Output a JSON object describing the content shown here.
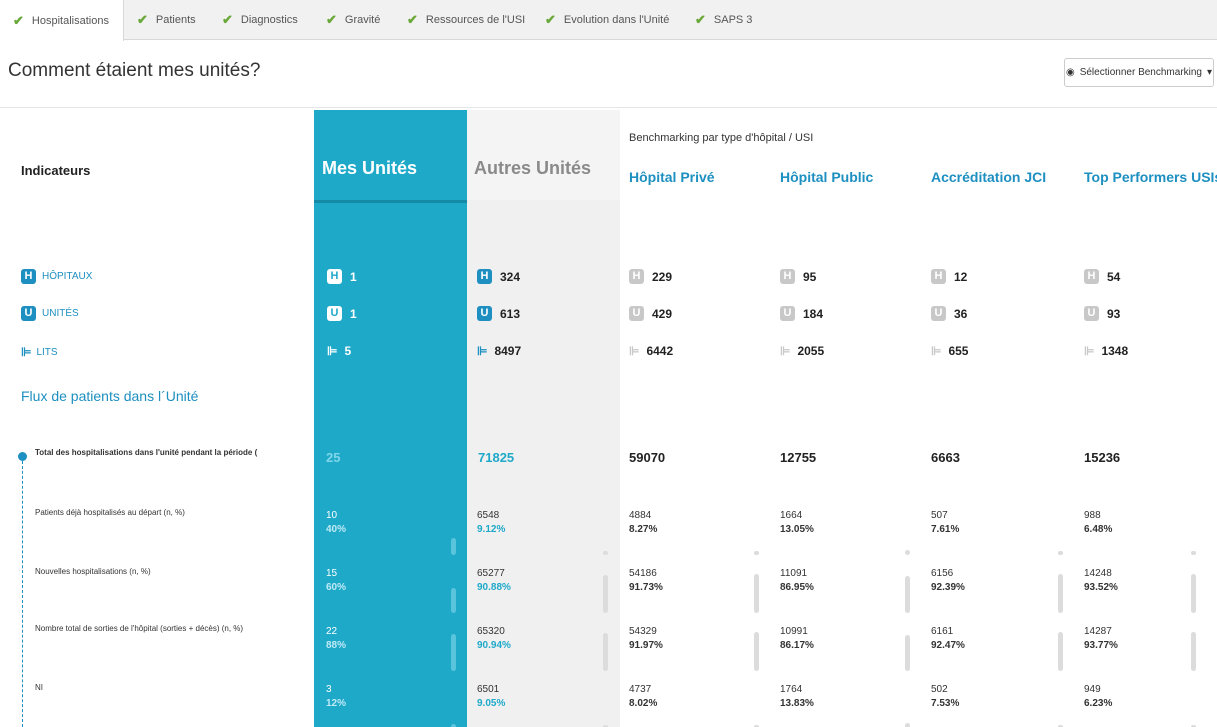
{
  "tabs": [
    {
      "label": "Hospitalisations",
      "active": true
    },
    {
      "label": "Patients"
    },
    {
      "label": "Diagnostics"
    },
    {
      "label": "Gravité"
    },
    {
      "label": "Ressources de l'USI"
    },
    {
      "label": "Evolution dans l'Unité"
    },
    {
      "label": "SAPS 3"
    }
  ],
  "page_title": "Comment étaient mes unités?",
  "bench_button": "Sélectionner Benchmarking",
  "headers": {
    "indicators": "Indicateurs",
    "mine": "Mes Unités",
    "other": "Autres Unités",
    "bench_title": "Benchmarking par type d'hôpital / USI",
    "bench": [
      "Hôpital Privé",
      "Hôpital Public",
      "Accréditation JCI",
      "Top Performers USIs"
    ]
  },
  "counts": {
    "labels": {
      "hospitals": "HÔPITAUX",
      "units": "UNITÉS",
      "beds": "LITS"
    },
    "icon_letters": {
      "hospital": "H",
      "unit": "U"
    },
    "hospitals": [
      "1",
      "324",
      "229",
      "95",
      "12",
      "54"
    ],
    "units": [
      "1",
      "613",
      "429",
      "184",
      "36",
      "93"
    ],
    "beds": [
      "5",
      "8497",
      "6442",
      "2055",
      "655",
      "1348"
    ]
  },
  "flux_title": "Flux de patients dans l´Unité",
  "total_row": {
    "label": "Total des hospitalisations dans l'unité pendant la période (",
    "values": [
      "25",
      "71825",
      "59070",
      "12755",
      "6663",
      "15236"
    ]
  },
  "rows": [
    {
      "label": "Patients déjà hospitalisés au départ (n, %)",
      "n": [
        "10",
        "6548",
        "4884",
        "1664",
        "507",
        "988"
      ],
      "p": [
        "40%",
        "9.12%",
        "8.27%",
        "13.05%",
        "7.61%",
        "6.48%"
      ]
    },
    {
      "label": "Nouvelles hospitalisations (n, %)",
      "n": [
        "15",
        "65277",
        "54186",
        "11091",
        "6156",
        "14248"
      ],
      "p": [
        "60%",
        "90.88%",
        "91.73%",
        "86.95%",
        "92.39%",
        "93.52%"
      ]
    },
    {
      "label": "Nombre total de sorties de l'hôpital (sorties + décès) (n, %)",
      "n": [
        "22",
        "65320",
        "54329",
        "10991",
        "6161",
        "14287"
      ],
      "p": [
        "88%",
        "90.94%",
        "91.97%",
        "86.17%",
        "92.47%",
        "93.77%"
      ]
    },
    {
      "label": "NI",
      "n": [
        "3",
        "6501",
        "4737",
        "1764",
        "502",
        "949"
      ],
      "p": [
        "12%",
        "9.05%",
        "8.02%",
        "13.83%",
        "7.53%",
        "6.23%"
      ]
    }
  ],
  "colors": {
    "accent": "#1fa9c9",
    "link": "#1d8fc0",
    "check": "#6aa83a"
  }
}
